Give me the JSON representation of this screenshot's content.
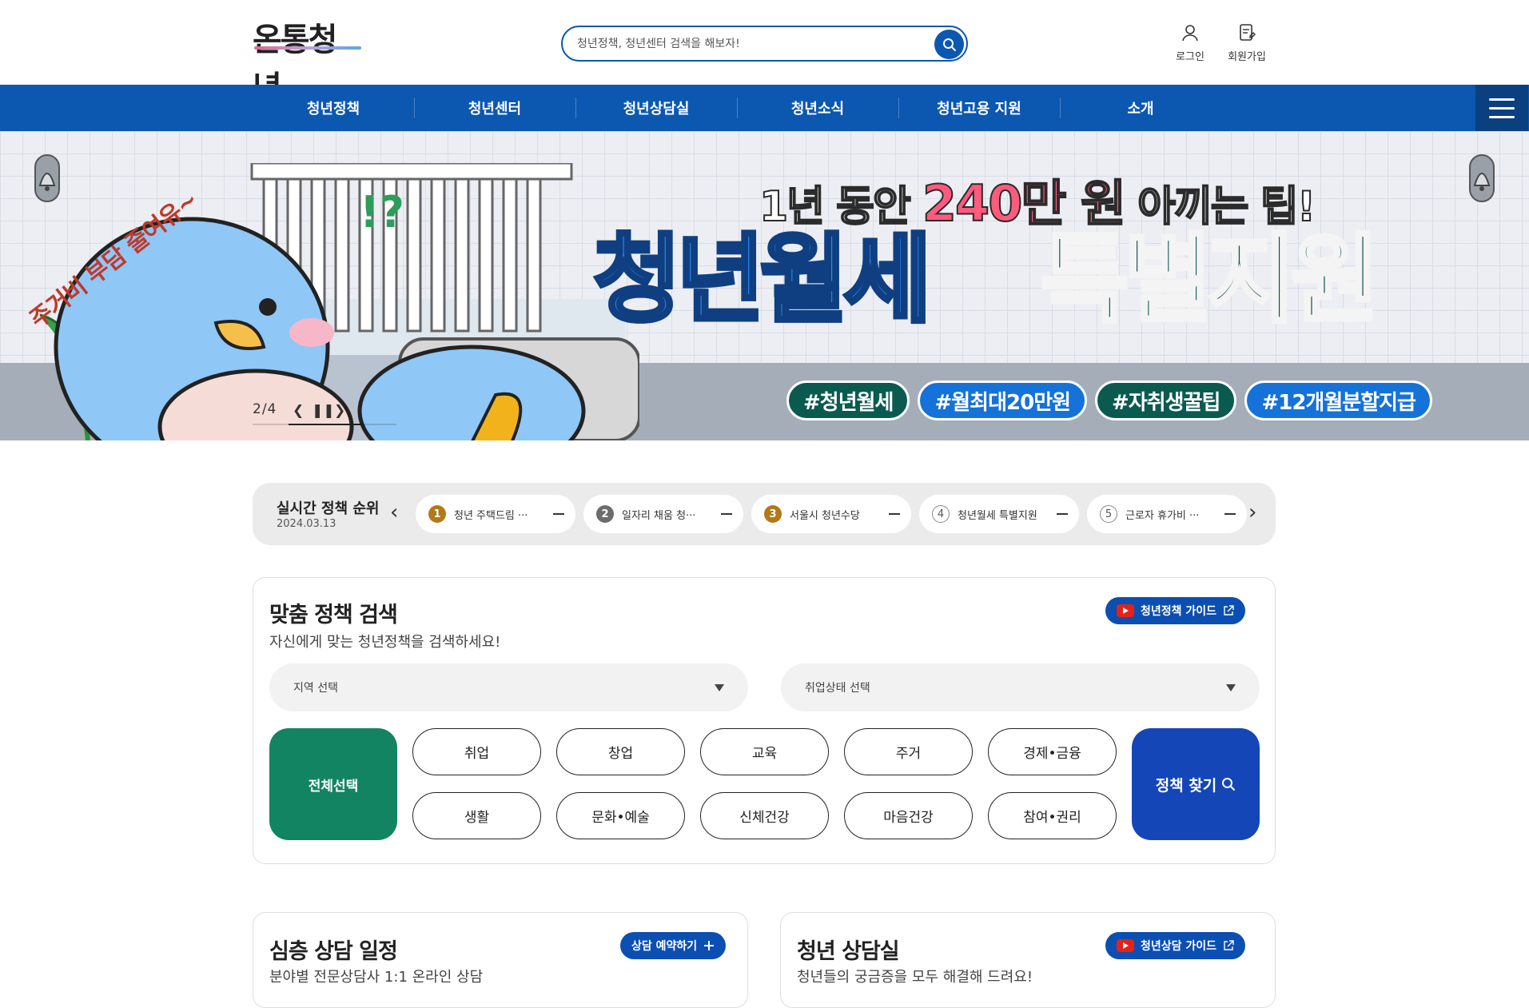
{
  "brand": {
    "logo_text": "온통청년"
  },
  "search": {
    "placeholder": "청년정책, 청년센터 검색을 해보자!"
  },
  "utility": {
    "login": "로그인",
    "signup": "회원가입"
  },
  "gnb": {
    "items": [
      "청년정책",
      "청년센터",
      "청년상담실",
      "청년소식",
      "청년고용 지원",
      "소개"
    ]
  },
  "banner": {
    "line1_a": "1년 동안",
    "line1_highlight": "240만 원",
    "line1_b": "아끼는 팁!",
    "line2_a": "청년월세",
    "line2_b": "특별지원",
    "side_text": "주거비 부담 줄여유~",
    "tags": [
      "#청년월세",
      "#월최대20만원",
      "#자취생꿀팁",
      "#12개월분할지급"
    ],
    "pager": "2/4"
  },
  "ranking": {
    "title": "실시간 정책 순위",
    "date": "2024.03.13",
    "items": [
      {
        "rank": "1",
        "label": "청년 주택드림 ···"
      },
      {
        "rank": "2",
        "label": "일자리 채움 청···"
      },
      {
        "rank": "3",
        "label": "서울시 청년수당"
      },
      {
        "rank": "4",
        "label": "청년월세 특별지원"
      },
      {
        "rank": "5",
        "label": "근로자 휴가비 ···"
      }
    ]
  },
  "policy_search": {
    "title": "맞춤 정책 검색",
    "subtitle": "자신에게 맞는 청년정책을 검색하세요!",
    "guide_button": "청년정책 가이드",
    "region_select": "지역 선택",
    "employment_select": "취업상태 선택",
    "select_all": "전체선택",
    "find_button": "정책 찾기",
    "categories": [
      "취업",
      "창업",
      "교육",
      "주거",
      "경제•금융",
      "생활",
      "문화•예술",
      "신체건강",
      "마음건강",
      "참여•권리"
    ]
  },
  "cards": {
    "counsel_schedule": {
      "title": "심층 상담 일정",
      "subtitle": "분야별 전문상담사 1:1 온라인 상담",
      "button": "상담 예약하기"
    },
    "counsel_room": {
      "title": "청년 상담실",
      "subtitle": "청년들의 궁금증을 모두 해결해 드려요!",
      "button": "청년상담 가이드"
    }
  },
  "colors": {
    "primary": "#0c58b0",
    "green": "#128462",
    "find": "#1446b8"
  }
}
